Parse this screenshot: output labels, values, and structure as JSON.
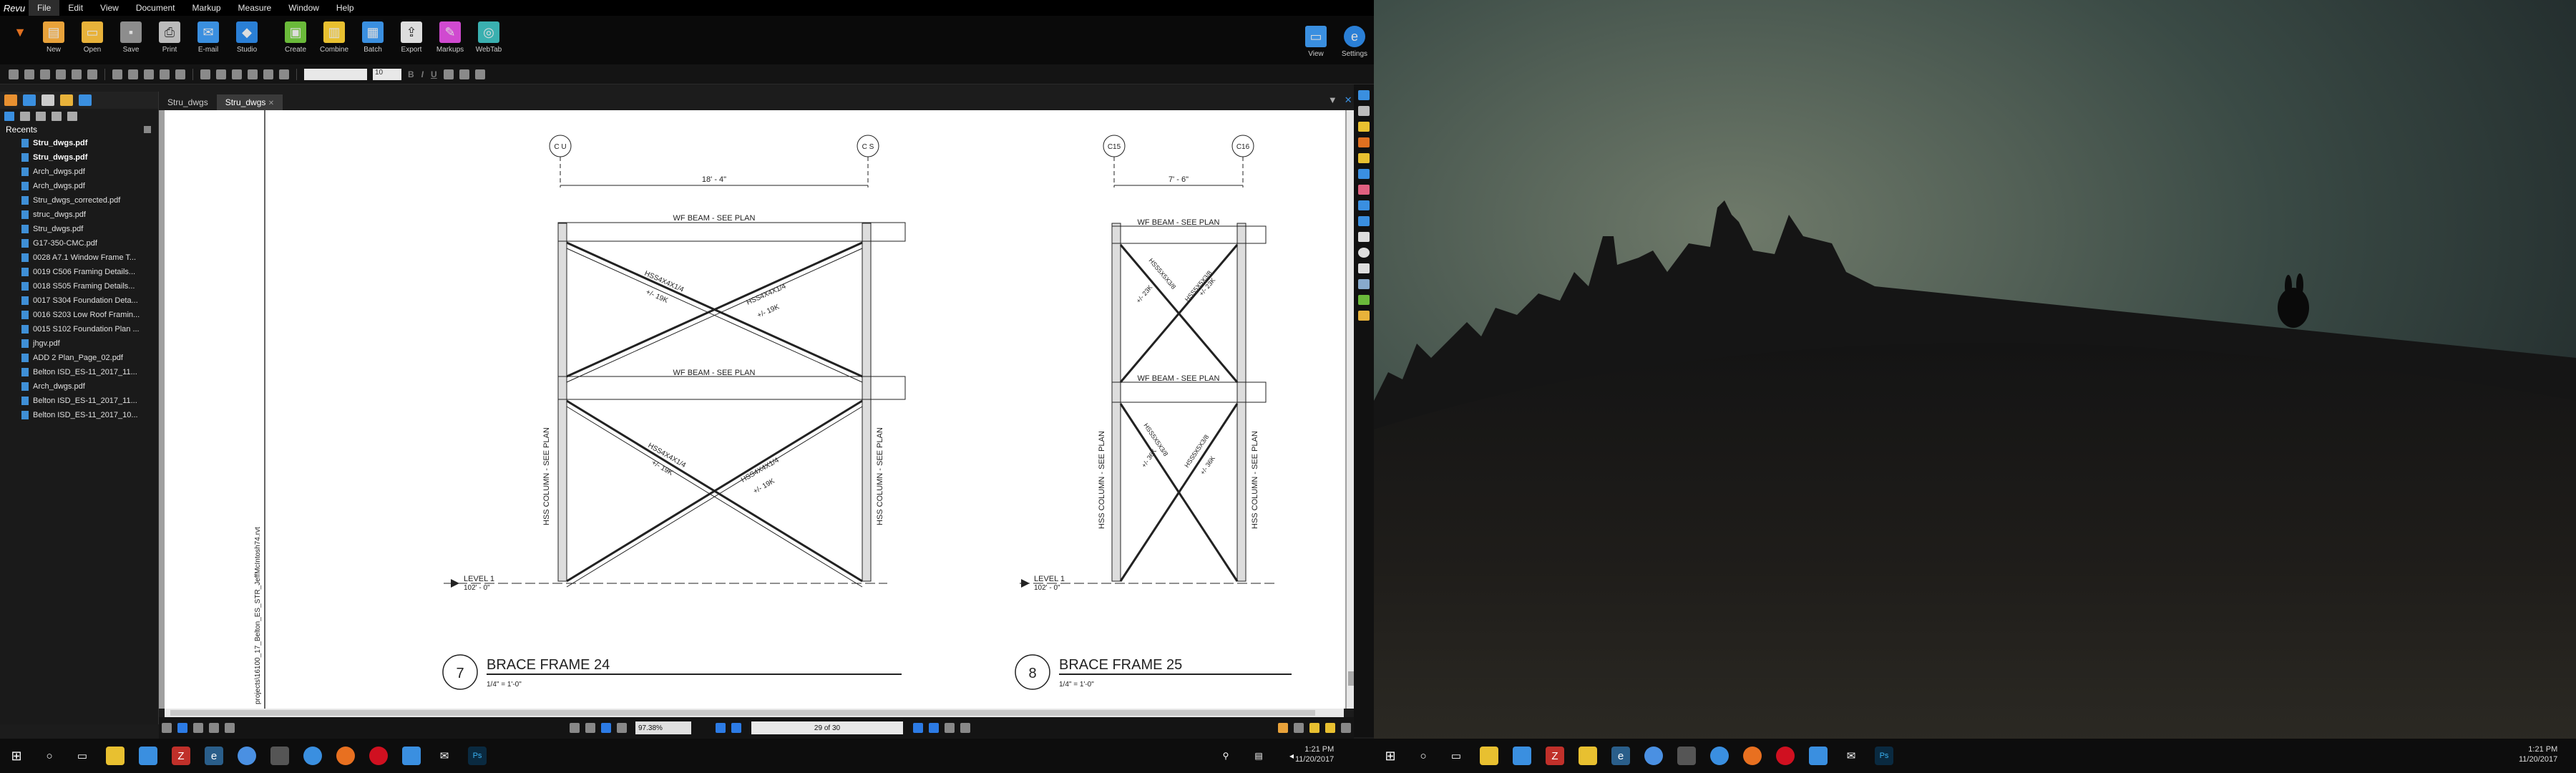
{
  "app": {
    "logo": "Revu",
    "menus": [
      "File",
      "Edit",
      "View",
      "Document",
      "Markup",
      "Measure",
      "Window",
      "Help"
    ]
  },
  "ribbon": {
    "left": [
      {
        "label": "New",
        "icon": "new-icon",
        "color": "#e8a23a"
      },
      {
        "label": "Open",
        "icon": "open-icon",
        "color": "#e8b23a"
      },
      {
        "label": "Save",
        "icon": "save-icon",
        "color": "#999"
      },
      {
        "label": "Print",
        "icon": "print-icon",
        "color": "#bbb"
      },
      {
        "label": "E-mail",
        "icon": "email-icon",
        "color": "#3a8fe0"
      },
      {
        "label": "Studio",
        "icon": "studio-icon",
        "color": "#2a7fd6"
      }
    ],
    "middle": [
      {
        "label": "Create",
        "icon": "create-icon",
        "color": "#6aba3a"
      },
      {
        "label": "Combine",
        "icon": "combine-icon",
        "color": "#e8c030"
      },
      {
        "label": "Batch",
        "icon": "batch-icon",
        "color": "#3a8fe0"
      },
      {
        "label": "Export",
        "icon": "export-icon",
        "color": "#ddd"
      },
      {
        "label": "Markups",
        "icon": "markups-icon",
        "color": "#d04ad0"
      },
      {
        "label": "WebTab",
        "icon": "webtab-icon",
        "color": "#3ab0b0"
      }
    ],
    "right": [
      {
        "label": "View",
        "icon": "view-icon",
        "color": "#3a8fe0"
      },
      {
        "label": "Settings",
        "icon": "settings-icon",
        "color": "#2a7fd6"
      }
    ]
  },
  "toolbar2": {
    "font_size": "10",
    "bold": "B",
    "italic": "I",
    "underline": "U"
  },
  "panel": {
    "recents_title": "Recents",
    "files": [
      {
        "name": "Stru_dwgs.pdf",
        "bold": true
      },
      {
        "name": "Stru_dwgs.pdf",
        "bold": true
      },
      {
        "name": "Arch_dwgs.pdf",
        "bold": false
      },
      {
        "name": "Arch_dwgs.pdf",
        "bold": false
      },
      {
        "name": "Stru_dwgs_corrected.pdf",
        "bold": false
      },
      {
        "name": "struc_dwgs.pdf",
        "bold": false
      },
      {
        "name": "Stru_dwgs.pdf",
        "bold": false
      },
      {
        "name": "G17-350-CMC.pdf",
        "bold": false
      },
      {
        "name": "0028 A7.1 Window Frame T...",
        "bold": false
      },
      {
        "name": "0019 C506 Framing Details...",
        "bold": false
      },
      {
        "name": "0018 S505 Framing Details...",
        "bold": false
      },
      {
        "name": "0017 S304 Foundation Deta...",
        "bold": false
      },
      {
        "name": "0016 S203 Low Roof Framin...",
        "bold": false
      },
      {
        "name": "0015 S102 Foundation Plan ...",
        "bold": false
      },
      {
        "name": "jhgv.pdf",
        "bold": false
      },
      {
        "name": "ADD 2 Plan_Page_02.pdf",
        "bold": false
      },
      {
        "name": "Belton ISD_ES-11_2017_11...",
        "bold": false
      },
      {
        "name": "Arch_dwgs.pdf",
        "bold": false
      },
      {
        "name": "Belton ISD_ES-11_2017_11...",
        "bold": false
      },
      {
        "name": "Belton ISD_ES-11_2017_10...",
        "bold": false
      }
    ]
  },
  "tabs": [
    {
      "label": "Stru_dwgs",
      "active": false
    },
    {
      "label": "Stru_dwgs",
      "active": true
    }
  ],
  "drawing": {
    "side_text": "projects\\16100_17_Belton_ES_STR_JeffMcIntosh74.rvt",
    "frame_a": {
      "grid_left": "C U",
      "grid_right": "C S",
      "dim": "18' - 4\"",
      "beam_top": "WF BEAM - SEE PLAN",
      "beam_mid": "WF BEAM - SEE PLAN",
      "brace1": "HSS4X4X1/4",
      "brace2": "HSS4X4X1/4",
      "brace3": "HSS4X4X1/4",
      "brace4": "HSS4X4X1/4",
      "force1": "+/- 19K",
      "force2": "+/- 19K",
      "force3": "+/- 19K",
      "force4": "+/- 19K",
      "col_left": "HSS COLUMN - SEE PLAN",
      "col_right": "HSS COLUMN - SEE PLAN",
      "level": "LEVEL 1",
      "level_elev": "102' - 0\"",
      "num": "7",
      "title": "BRACE FRAME 24",
      "scale": "1/4\" = 1'-0\""
    },
    "frame_b": {
      "grid_left": "C15",
      "grid_right": "C16",
      "dim": "7' - 6\"",
      "beam_top": "WF BEAM - SEE PLAN",
      "beam_mid": "WF BEAM - SEE PLAN",
      "brace1": "HSS5X5X3/8",
      "brace2": "HSS5X5X3/8",
      "brace3": "HSS5X5X3/8",
      "brace4": "HSS5X5X3/8",
      "force1": "+/- 23K",
      "force2": "+/- 23K",
      "force3": "+/- 36K",
      "force4": "+/- 36K",
      "col_left": "HSS COLUMN - SEE PLAN",
      "col_right": "HSS COLUMN - SEE PLAN",
      "level": "LEVEL 1",
      "level_elev": "102' - 0\"",
      "num": "8",
      "title": "BRACE FRAME 25",
      "scale": "1/4\" = 1'-0\""
    }
  },
  "status": {
    "zoom": "97.38%",
    "page": "29 of 30"
  },
  "taskbar": {
    "clock_time": "1:21 PM",
    "clock_date": "11/20/2017",
    "clock2_time": "1:21 PM",
    "clock2_date": "11/20/2017"
  }
}
